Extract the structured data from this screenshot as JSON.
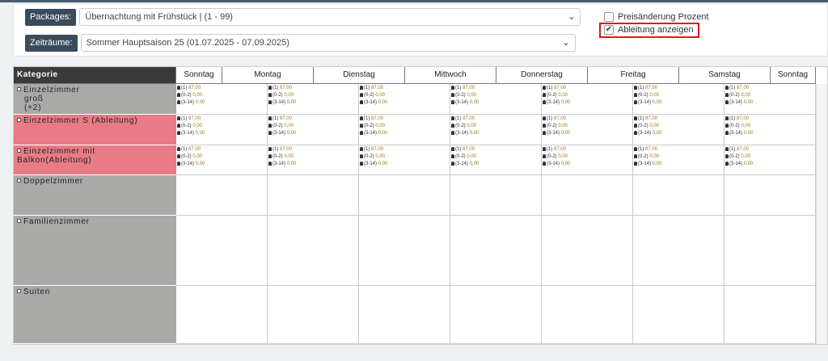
{
  "filters": {
    "packages_label": "Packages:",
    "packages_value": "Übernachtung mit Frühstück | (1 - 99)",
    "periods_label": "Zeiträume:",
    "periods_value": "Sommer Hauptsaison 25 (01.07.2025 - 07.09.2025)",
    "price_change_percent": "Preisänderung Prozent",
    "show_derivation": "Ableitung anzeigen",
    "price_change_checked": false,
    "show_derivation_checked": true
  },
  "grid": {
    "kategorie": "Kategorie",
    "days": [
      "Sonntag",
      "Montag",
      "Dienstag",
      "Mittwoch",
      "Donnerstag",
      "Freitag",
      "Samstag",
      "Sonntag"
    ],
    "prices": [
      {
        "label": "(1)",
        "value": "87,00"
      },
      {
        "label": "(0-2)",
        "value": "0,00"
      },
      {
        "label": "(3-14)",
        "value": "0,00"
      }
    ],
    "categories": [
      {
        "name_lines": [
          "Einzelzimmer",
          "groß",
          "(+2)"
        ],
        "color": "#a9aaa8",
        "has_prices": true
      },
      {
        "name_lines": [
          "Einzelzimmer S (Ableitung)"
        ],
        "color": "#e87b85",
        "has_prices": true
      },
      {
        "name_lines": [
          "Einzelzimmer mit Balkon(Ableitung)"
        ],
        "color": "#e87b85",
        "has_prices": true
      },
      {
        "name_lines": [
          "Doppelzimmer"
        ],
        "color": "#a9aaa8",
        "has_prices": false
      },
      {
        "name_lines": [
          "Familienzimmer"
        ],
        "color": "#a9aaa8",
        "has_prices": false
      },
      {
        "name_lines": [
          "Suiten"
        ],
        "color": "#a9aaa8",
        "has_prices": false
      }
    ]
  }
}
